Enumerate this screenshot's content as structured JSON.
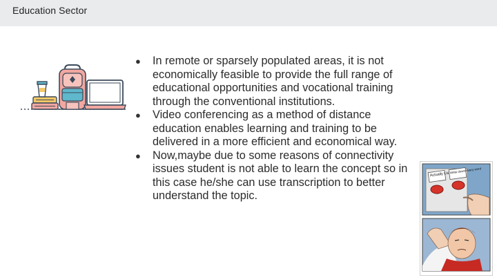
{
  "header": {
    "title": "Education Sector"
  },
  "bullets": [
    "In remote or sparsely populated areas, it is not economically feasible to provide the full range of educational opportunities and vocational training through the conventional institutions.",
    "Video conferencing as a method of distance education enables learning and training to be delivered in a more efficient and economical way.",
    "Now,maybe due to some reasons of connectivity issues student is not able to learn the concept so in this case he/she can use transcription to better understand the topic."
  ],
  "meme": {
    "button_left": "Actually Listen",
    "button_right": "Write down every word"
  },
  "colors": {
    "title_bar": "#e9ebed",
    "text": "#2b2b2b",
    "backpack": "#f2a7a0",
    "accent_blue": "#5fb8cc",
    "accent_yellow": "#f4c766",
    "button_red": "#d6342a"
  },
  "icons": [
    "education-clipart",
    "backpack-icon",
    "laptop-icon",
    "books-icon",
    "cup-icon",
    "two-buttons-meme"
  ]
}
